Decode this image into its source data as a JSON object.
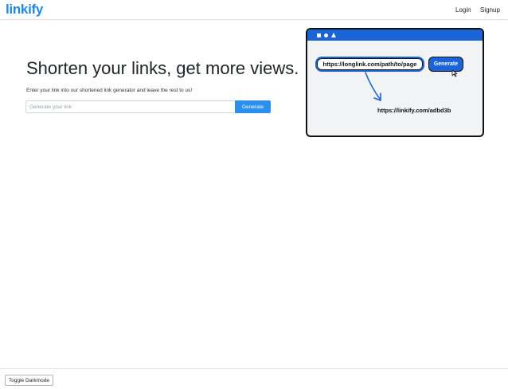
{
  "nav": {
    "brand": "linkify",
    "login": "Login",
    "signup": "Signup"
  },
  "hero": {
    "title": "Shorten your links, get more views.",
    "subtitle": "Enter your link into our shortened link generator and leave the rest to us!",
    "input_placeholder": "Generate your link",
    "input_value": "",
    "button_label": "Generate"
  },
  "illustration": {
    "long_url": "https://longlink.com/path/to/page",
    "button_label": "Generate",
    "short_url": "https://linkify.com/adbd3b",
    "colors": {
      "accent": "#1a64d8",
      "border": "#111111",
      "background": "#f2f3f5"
    }
  },
  "footer": {
    "toggle_label": "Toggle Darkmode"
  },
  "colors": {
    "brand": "#1e88e5",
    "primary_button": "#2b8fec"
  }
}
